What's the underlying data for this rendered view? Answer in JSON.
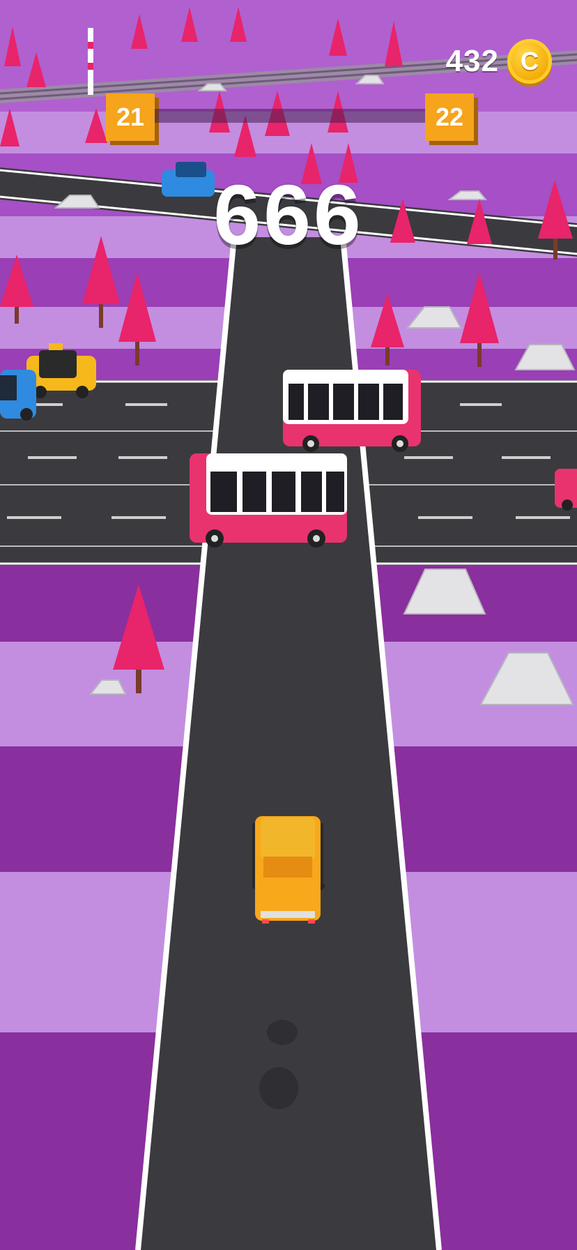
{
  "hud": {
    "coins": "432",
    "coin_symbol": "C",
    "level_current": "21",
    "level_next": "22",
    "level_progress": 0,
    "score": "666"
  },
  "colors": {
    "sky_band_light": "#c38ee0",
    "sky_band_dark": "#8a2f9e",
    "road": "#3b3a3f",
    "road_edge": "#ffffff",
    "accent_coin": "#f5a41c",
    "tree": "#e8246a",
    "bus_body": "#e9336e",
    "player_car": "#f7a81b"
  }
}
